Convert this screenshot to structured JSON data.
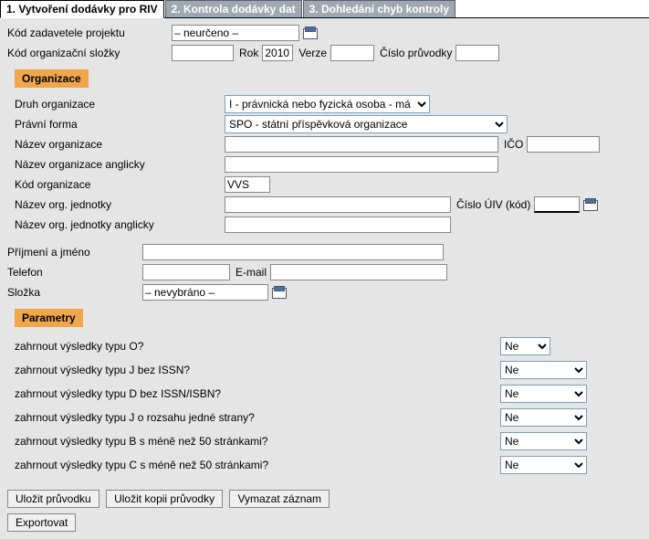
{
  "tabs": {
    "t1": "1. Vytvoření dodávky pro RIV",
    "t2": "2. Kontrola dodávky dat",
    "t3": "3. Dohledání chyb kontroly"
  },
  "top": {
    "kod_zadavatele_label": "Kód zadavetele projektu",
    "kod_zadavatele_value": "– neurčeno –",
    "kod_org_slozky_label": "Kód organizační složky",
    "kod_org_slozky_value": "",
    "rok_label": "Rok",
    "rok_value": "2010",
    "verze_label": "Verze",
    "verze_value": "",
    "cislo_pruvodky_label": "Číslo průvodky",
    "cislo_pruvodky_value": ""
  },
  "sections": {
    "organizace": "Organizace",
    "parametry": "Parametry"
  },
  "org": {
    "druh_label": "Druh organizace",
    "druh_value": "I - právnická nebo fyzická osoba - má IČO",
    "pravni_forma_label": "Právní forma",
    "pravni_forma_value": "SPO - státní příspěvková organizace",
    "nazev_label": "Název organizace",
    "nazev_value": "",
    "ico_label": "IČO",
    "ico_value": "",
    "nazev_en_label": "Název organizace anglicky",
    "nazev_en_value": "",
    "kod_org_label": "Kód organizace",
    "kod_org_value": "VVS",
    "nazev_jednotky_label": "Název org. jednotky",
    "nazev_jednotky_value": "",
    "cislo_uiv_label": "Číslo ÚIV (kód)",
    "cislo_uiv_value": "",
    "nazev_jednotky_en_label": "Název org. jednotky anglicky",
    "nazev_jednotky_en_value": ""
  },
  "person": {
    "prijmeni_label": "Příjmení a jméno",
    "prijmeni_value": "",
    "telefon_label": "Telefon",
    "telefon_value": "",
    "email_label": "E-mail",
    "email_value": "",
    "slozka_label": "Složka",
    "slozka_value": "– nevybráno –"
  },
  "params": {
    "opt_ne": "Ne",
    "p1": "zahrnout výsledky typu O?",
    "p2": "zahrnout výsledky typu J bez ISSN?",
    "p3": "zahrnout výsledky typu D bez ISSN/ISBN?",
    "p4": "zahrnout výsledky typu J o rozsahu jedné strany?",
    "p5": "zahrnout výsledky typu B s méně než 50 stránkami?",
    "p6": "zahrnout výsledky typu C s méně než 50 stránkami?"
  },
  "buttons": {
    "ulozit": "Uložit průvodku",
    "ulozit_kopii": "Uložit kopii průvodky",
    "vymazat": "Vymazat záznam",
    "export": "Exportovat"
  }
}
